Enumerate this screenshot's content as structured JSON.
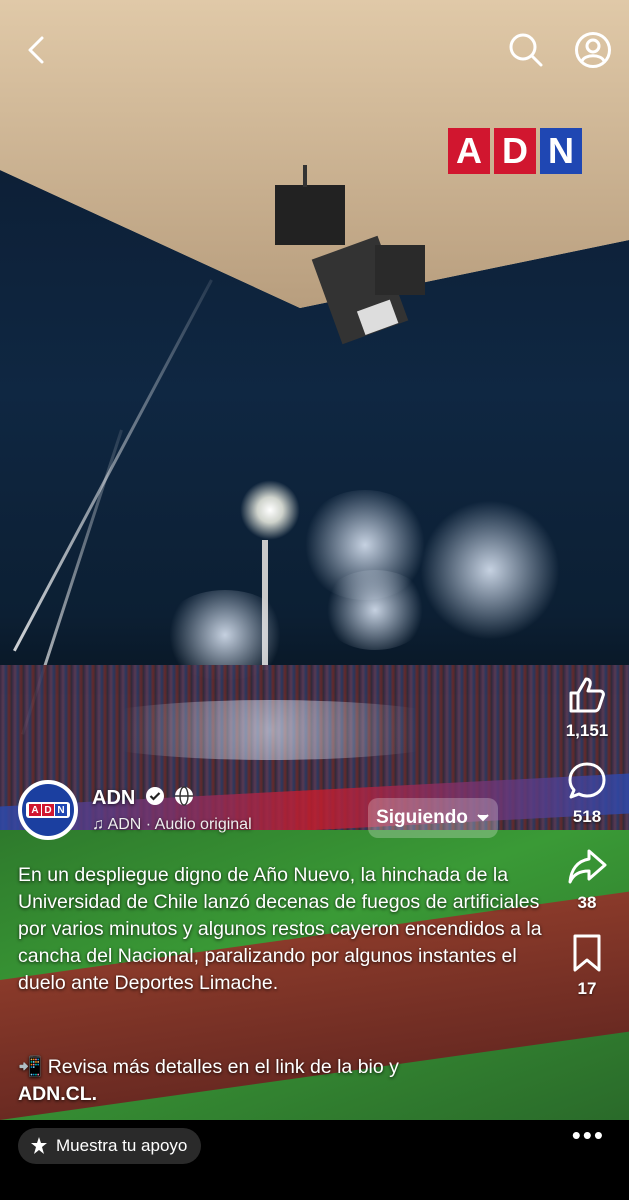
{
  "brand": {
    "logo_letters": [
      "A",
      "D",
      "N"
    ],
    "logo_colors": [
      "#d1162f",
      "#d1162f",
      "#1f47b3"
    ]
  },
  "header": {
    "back_icon": "chevron-left-icon",
    "search_icon": "search-icon",
    "profile_icon": "profile-icon"
  },
  "author": {
    "name": "ADN",
    "audio": "ADN · Audio original",
    "follow_label": "Siguiendo"
  },
  "actions": {
    "likes": "1,151",
    "comments": "518",
    "shares": "38",
    "saves": "17"
  },
  "caption": {
    "text": "En un despliegue digno de Año Nuevo, la hinchada de la Universidad de Chile lanzó decenas de fuegos de artificiales por varios minutos y algunos restos cayeron encendidos a la cancha del Nacional, paralizando por algunos instantes el duelo ante Deportes Limache.",
    "more_text": "📲 Revisa más detalles en el link de la bio y",
    "link_text": "ADN.CL."
  },
  "footer": {
    "support_label": "Muestra tu apoyo",
    "more_label": "•••"
  }
}
